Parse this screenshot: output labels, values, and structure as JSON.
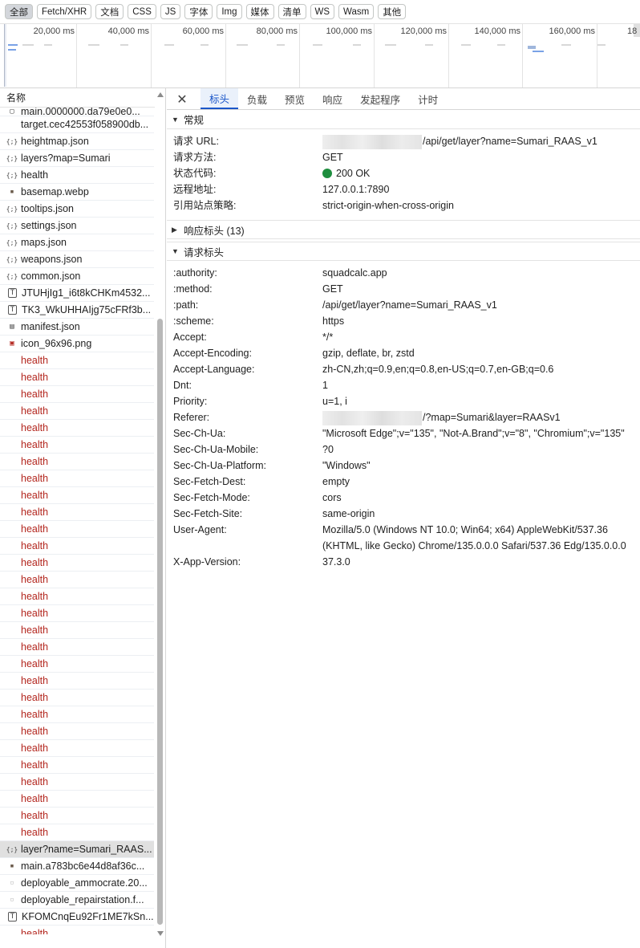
{
  "filters": [
    "全部",
    "Fetch/XHR",
    "文档",
    "CSS",
    "JS",
    "字体",
    "Img",
    "媒体",
    "清单",
    "WS",
    "Wasm",
    "其他"
  ],
  "timeline": {
    "labels": [
      "20,000 ms",
      "40,000 ms",
      "60,000 ms",
      "80,000 ms",
      "100,000 ms",
      "120,000 ms",
      "140,000 ms",
      "160,000 ms",
      "18"
    ]
  },
  "list": {
    "header": "名称",
    "rows": [
      {
        "name": "main.0000000.da79e0e0...",
        "icon": "partial",
        "type": "partial"
      },
      {
        "name": "target.cec42553f058900db...",
        "icon": "none",
        "type": "normal"
      },
      {
        "name": "heightmap.json",
        "icon": "json-icon",
        "type": "normal"
      },
      {
        "name": "layers?map=Sumari",
        "icon": "json-icon",
        "type": "normal"
      },
      {
        "name": "health",
        "icon": "json-icon",
        "type": "normal"
      },
      {
        "name": "basemap.webp",
        "icon": "image-icon",
        "type": "normal"
      },
      {
        "name": "tooltips.json",
        "icon": "json-icon",
        "type": "normal"
      },
      {
        "name": "settings.json",
        "icon": "json-icon",
        "type": "normal"
      },
      {
        "name": "maps.json",
        "icon": "json-icon",
        "type": "normal"
      },
      {
        "name": "weapons.json",
        "icon": "json-icon",
        "type": "normal"
      },
      {
        "name": "common.json",
        "icon": "json-icon",
        "type": "normal"
      },
      {
        "name": "JTUHjIg1_i6t8kCHKm4532...",
        "icon": "font-icon",
        "type": "normal"
      },
      {
        "name": "TK3_WkUHHAIjg75cFRf3b...",
        "icon": "font-icon",
        "type": "normal"
      },
      {
        "name": "manifest.json",
        "icon": "manifest-icon",
        "type": "normal"
      },
      {
        "name": "icon_96x96.png",
        "icon": "png-icon",
        "type": "normal"
      },
      {
        "name": "health",
        "icon": "none",
        "type": "err"
      },
      {
        "name": "health",
        "icon": "none",
        "type": "err"
      },
      {
        "name": "health",
        "icon": "none",
        "type": "err"
      },
      {
        "name": "health",
        "icon": "none",
        "type": "err"
      },
      {
        "name": "health",
        "icon": "none",
        "type": "err"
      },
      {
        "name": "health",
        "icon": "none",
        "type": "err"
      },
      {
        "name": "health",
        "icon": "none",
        "type": "err"
      },
      {
        "name": "health",
        "icon": "none",
        "type": "err"
      },
      {
        "name": "health",
        "icon": "none",
        "type": "err"
      },
      {
        "name": "health",
        "icon": "none",
        "type": "err"
      },
      {
        "name": "health",
        "icon": "none",
        "type": "err"
      },
      {
        "name": "health",
        "icon": "none",
        "type": "err"
      },
      {
        "name": "health",
        "icon": "none",
        "type": "err"
      },
      {
        "name": "health",
        "icon": "none",
        "type": "err"
      },
      {
        "name": "health",
        "icon": "none",
        "type": "err"
      },
      {
        "name": "health",
        "icon": "none",
        "type": "err"
      },
      {
        "name": "health",
        "icon": "none",
        "type": "err"
      },
      {
        "name": "health",
        "icon": "none",
        "type": "err"
      },
      {
        "name": "health",
        "icon": "none",
        "type": "err"
      },
      {
        "name": "health",
        "icon": "none",
        "type": "err"
      },
      {
        "name": "health",
        "icon": "none",
        "type": "err"
      },
      {
        "name": "health",
        "icon": "none",
        "type": "err"
      },
      {
        "name": "health",
        "icon": "none",
        "type": "err"
      },
      {
        "name": "health",
        "icon": "none",
        "type": "err"
      },
      {
        "name": "health",
        "icon": "none",
        "type": "err"
      },
      {
        "name": "health",
        "icon": "none",
        "type": "err"
      },
      {
        "name": "health",
        "icon": "none",
        "type": "err"
      },
      {
        "name": "health",
        "icon": "none",
        "type": "err"
      },
      {
        "name": "health",
        "icon": "none",
        "type": "err"
      },
      {
        "name": "layer?name=Sumari_RAAS...",
        "icon": "json-icon",
        "type": "selected"
      },
      {
        "name": "main.a783bc6e44d8af36c...",
        "icon": "image-icon",
        "type": "normal"
      },
      {
        "name": "deployable_ammocrate.20...",
        "icon": "small-image-icon",
        "type": "normal"
      },
      {
        "name": "deployable_repairstation.f...",
        "icon": "small-image-icon",
        "type": "normal"
      },
      {
        "name": "KFOMCnqEu92Fr1ME7kSn...",
        "icon": "font-icon",
        "type": "normal"
      },
      {
        "name": "health",
        "icon": "none",
        "type": "err"
      },
      {
        "name": "health",
        "icon": "doc-icon",
        "type": "normal"
      }
    ]
  },
  "detail": {
    "tabs": [
      "标头",
      "负载",
      "预览",
      "响应",
      "发起程序",
      "计时"
    ],
    "general": {
      "title": "常规",
      "rows": [
        {
          "k": "请求 URL:",
          "v": "/api/get/layer?name=Sumari_RAAS_v1",
          "blur": true
        },
        {
          "k": "请求方法:",
          "v": "GET"
        },
        {
          "k": "状态代码:",
          "v": "200 OK",
          "status": true
        },
        {
          "k": "远程地址:",
          "v": "127.0.0.1:7890"
        },
        {
          "k": "引用站点策略:",
          "v": "strict-origin-when-cross-origin"
        }
      ]
    },
    "response_headers": {
      "title": "响应标头 (13)"
    },
    "request_headers": {
      "title": "请求标头",
      "rows": [
        {
          "k": ":authority:",
          "v": "squadcalc.app"
        },
        {
          "k": ":method:",
          "v": "GET"
        },
        {
          "k": ":path:",
          "v": "/api/get/layer?name=Sumari_RAAS_v1"
        },
        {
          "k": ":scheme:",
          "v": "https"
        },
        {
          "k": "Accept:",
          "v": "*/*"
        },
        {
          "k": "Accept-Encoding:",
          "v": "gzip, deflate, br, zstd"
        },
        {
          "k": "Accept-Language:",
          "v": "zh-CN,zh;q=0.9,en;q=0.8,en-US;q=0.7,en-GB;q=0.6"
        },
        {
          "k": "Dnt:",
          "v": "1"
        },
        {
          "k": "Priority:",
          "v": "u=1, i"
        },
        {
          "k": "Referer:",
          "v": "/?map=Sumari&layer=RAASv1",
          "blur": true
        },
        {
          "k": "Sec-Ch-Ua:",
          "v": "\"Microsoft Edge\";v=\"135\", \"Not-A.Brand\";v=\"8\", \"Chromium\";v=\"135\""
        },
        {
          "k": "Sec-Ch-Ua-Mobile:",
          "v": "?0"
        },
        {
          "k": "Sec-Ch-Ua-Platform:",
          "v": "\"Windows\""
        },
        {
          "k": "Sec-Fetch-Dest:",
          "v": "empty"
        },
        {
          "k": "Sec-Fetch-Mode:",
          "v": "cors"
        },
        {
          "k": "Sec-Fetch-Site:",
          "v": "same-origin"
        },
        {
          "k": "User-Agent:",
          "v": "Mozilla/5.0 (Windows NT 10.0; Win64; x64) AppleWebKit/537.36 (KHTML, like Gecko) Chrome/135.0.0.0 Safari/537.36 Edg/135.0.0.0"
        },
        {
          "k": "X-App-Version:",
          "v": "37.3.0"
        }
      ]
    }
  },
  "colors": {
    "accent": "#1a56c9",
    "error_text": "#b3261e",
    "status_ok": "#1e8e3e"
  }
}
